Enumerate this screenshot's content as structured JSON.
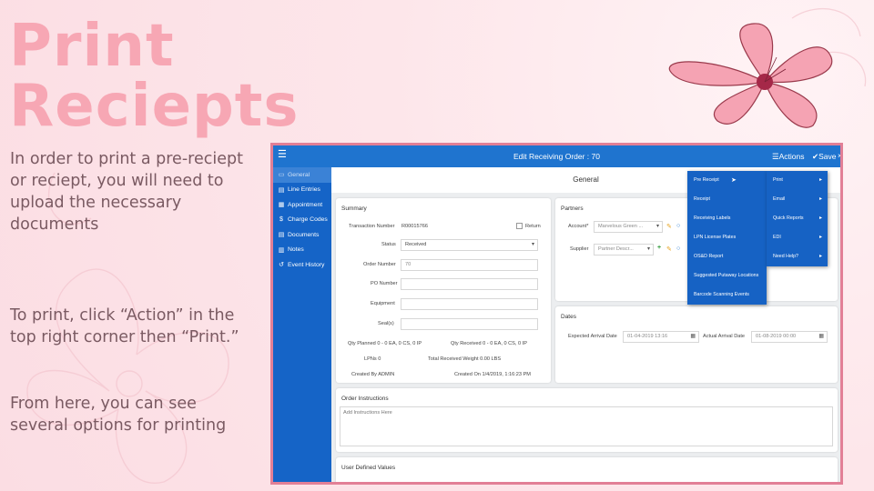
{
  "slide": {
    "title_line1": "Print",
    "title_line2": "Reciepts",
    "paragraph1": "In order to print a pre-reciept or reciept, you will need to upload the necessary documents",
    "paragraph2": "To print, click “Action” in the top right corner then “Print.”",
    "paragraph3": "From here, you can see several options for printing",
    "colors": {
      "title": "#f7a7b4",
      "text": "#7a5a62",
      "app_border": "#e27f96",
      "app_blue": "#1f74cf"
    }
  },
  "app": {
    "window_title": "Edit Receiving Order : 70",
    "actions_label": "Actions",
    "save_label": "Save",
    "close_label": "×",
    "page_header": "General",
    "sidebar": [
      {
        "label": "General",
        "icon": "general-icon"
      },
      {
        "label": "Line Entries",
        "icon": "list-icon"
      },
      {
        "label": "Appointment",
        "icon": "calendar-icon"
      },
      {
        "label": "Charge Codes",
        "icon": "dollar-icon"
      },
      {
        "label": "Documents",
        "icon": "document-icon"
      },
      {
        "label": "Notes",
        "icon": "notes-icon"
      },
      {
        "label": "Event History",
        "icon": "history-icon"
      }
    ],
    "summary": {
      "title": "Summary",
      "transaction_number_label": "Transaction Number",
      "transaction_number": "R00015766",
      "return_label": "Return",
      "status_label": "Status",
      "status_value": "Received",
      "order_number_label": "Order Number",
      "order_number_value": "70",
      "po_number_label": "PO Number",
      "equipment_label": "Equipment",
      "seals_label": "Seal(s)",
      "qty_planned": "Qty Planned   0 - 0 EA, 0 CS, 0 IP",
      "qty_received": "Qty Received   0 - 0 EA, 0 CS, 0 IP",
      "lpns": "LPNs   0",
      "total_received_weight": "Total Received Weight   0.00 LBS",
      "created_by": "Created By   ADMIN",
      "created_on": "Created On   1/4/2019, 1:16:23 PM"
    },
    "partners": {
      "title": "Partners",
      "account_label": "Account*",
      "account_value": "Marvelous Green ...",
      "supplier_label": "Supplier",
      "supplier_value": "Partner Descr..."
    },
    "dates": {
      "title": "Dates",
      "expected_label": "Expected Arrival Date",
      "expected_value": "01-04-2019 13:16",
      "actual_label": "Actual Arrival Date",
      "actual_value": "01-08-2019 00:00"
    },
    "order_instructions": {
      "title": "Order Instructions",
      "placeholder": "Add Instructions Here"
    },
    "user_defined": {
      "title": "User Defined Values"
    },
    "actions_menu": [
      {
        "label": "Pre Receipt"
      },
      {
        "label": "Receipt"
      },
      {
        "label": "Receiving Labels"
      },
      {
        "label": "LPN License Plates"
      },
      {
        "label": "OS&D Report"
      },
      {
        "label": "Suggested Putaway Locations"
      },
      {
        "label": "Barcode Scanning Events"
      }
    ],
    "actions_submenu": [
      {
        "label": "Print"
      },
      {
        "label": "Email"
      },
      {
        "label": "Quick Reports"
      },
      {
        "label": "EDI"
      },
      {
        "label": "Need Help?"
      }
    ]
  }
}
